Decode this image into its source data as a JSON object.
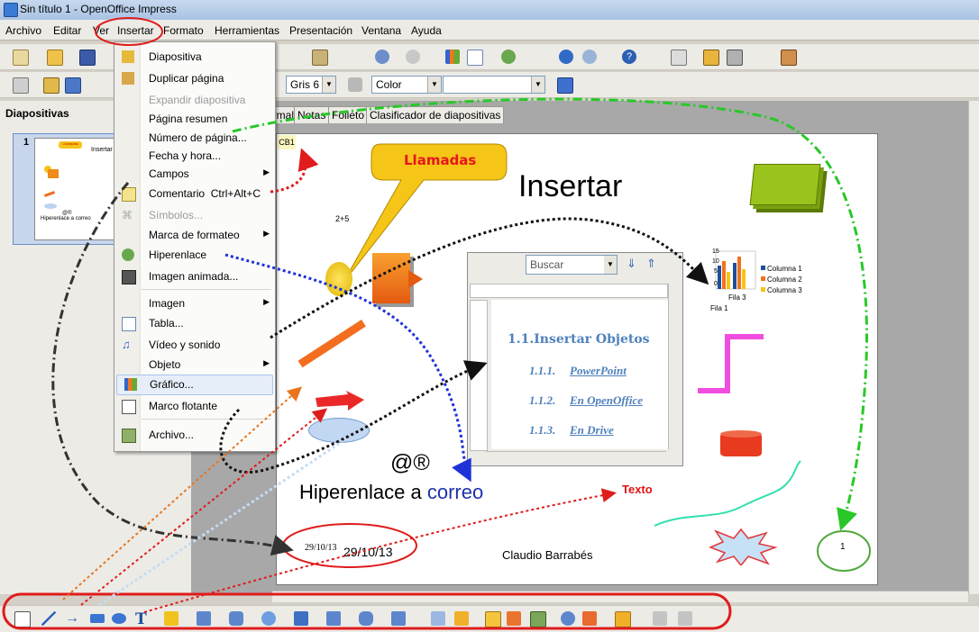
{
  "window": {
    "title": "Sin título 1 - OpenOffice Impress"
  },
  "menubar": {
    "items": [
      "Archivo",
      "Editar",
      "Ver",
      "Insertar",
      "Formato",
      "Herramientas",
      "Presentación",
      "Ventana",
      "Ayuda"
    ]
  },
  "toolbar2": {
    "line_color_value": "Gris 6",
    "area_style_value": "Color"
  },
  "slide_pane": {
    "title": "Diapositivas",
    "slide_number": "1"
  },
  "view_tabs": [
    "Normal",
    "Notas",
    "Folleto",
    "Clasificador de diapositivas"
  ],
  "insert_menu": {
    "items": [
      {
        "label": "Diapositiva"
      },
      {
        "label": "Duplicar página"
      },
      {
        "label": "Expandir diapositiva",
        "disabled": true
      },
      {
        "label": "Página resumen"
      },
      {
        "label": "Número de página..."
      },
      {
        "label": "Fecha y hora..."
      },
      {
        "label": "Campos",
        "submenu": true
      },
      {
        "label": "Comentario",
        "shortcut": "Ctrl+Alt+C"
      },
      {
        "label": "Símbolos...",
        "disabled": true
      },
      {
        "label": "Marca de formateo",
        "submenu": true
      },
      {
        "label": "Hiperenlace"
      },
      {
        "label": "Imagen animada..."
      },
      {
        "label": "Imagen",
        "submenu": true
      },
      {
        "label": "Tabla..."
      },
      {
        "label": "Vídeo y sonido"
      },
      {
        "label": "Objeto",
        "submenu": true
      },
      {
        "label": "Gráfico...",
        "highlighted": true
      },
      {
        "label": "Marco flotante"
      },
      {
        "label": "Archivo..."
      }
    ]
  },
  "slide": {
    "title": "Insertar",
    "callout_text": "Llamadas",
    "comment_marker": "CB1",
    "formula": "2+5",
    "symbols": "@®",
    "hyperlink_prefix": "Hiperenlace a",
    "hyperlink_word": "correo",
    "text_label": "Texto",
    "date_small": "29/10/13",
    "date_large": "29/10/13",
    "author": "Claudio Barrabés",
    "page_number": "1",
    "chart": {
      "legend": [
        "Columna 1",
        "Columna 2",
        "Columna 3"
      ],
      "ticks": [
        "15",
        "10",
        "5",
        "0"
      ],
      "labels": [
        "Fila 3",
        "Fila 1"
      ]
    },
    "writer": {
      "search_placeholder": "Buscar",
      "heading": "1.1.Insertar Objetos",
      "items": [
        {
          "num": "1.1.1.",
          "text": "PowerPoint"
        },
        {
          "num": "1.1.2.",
          "text": "En OpenOffice"
        },
        {
          "num": "1.1.3.",
          "text": "En Drive"
        }
      ]
    }
  },
  "thumb": {
    "callout": "Llamadas",
    "title": "Insertar",
    "symbols": "@®",
    "link": "Hiperenlace a correo"
  }
}
